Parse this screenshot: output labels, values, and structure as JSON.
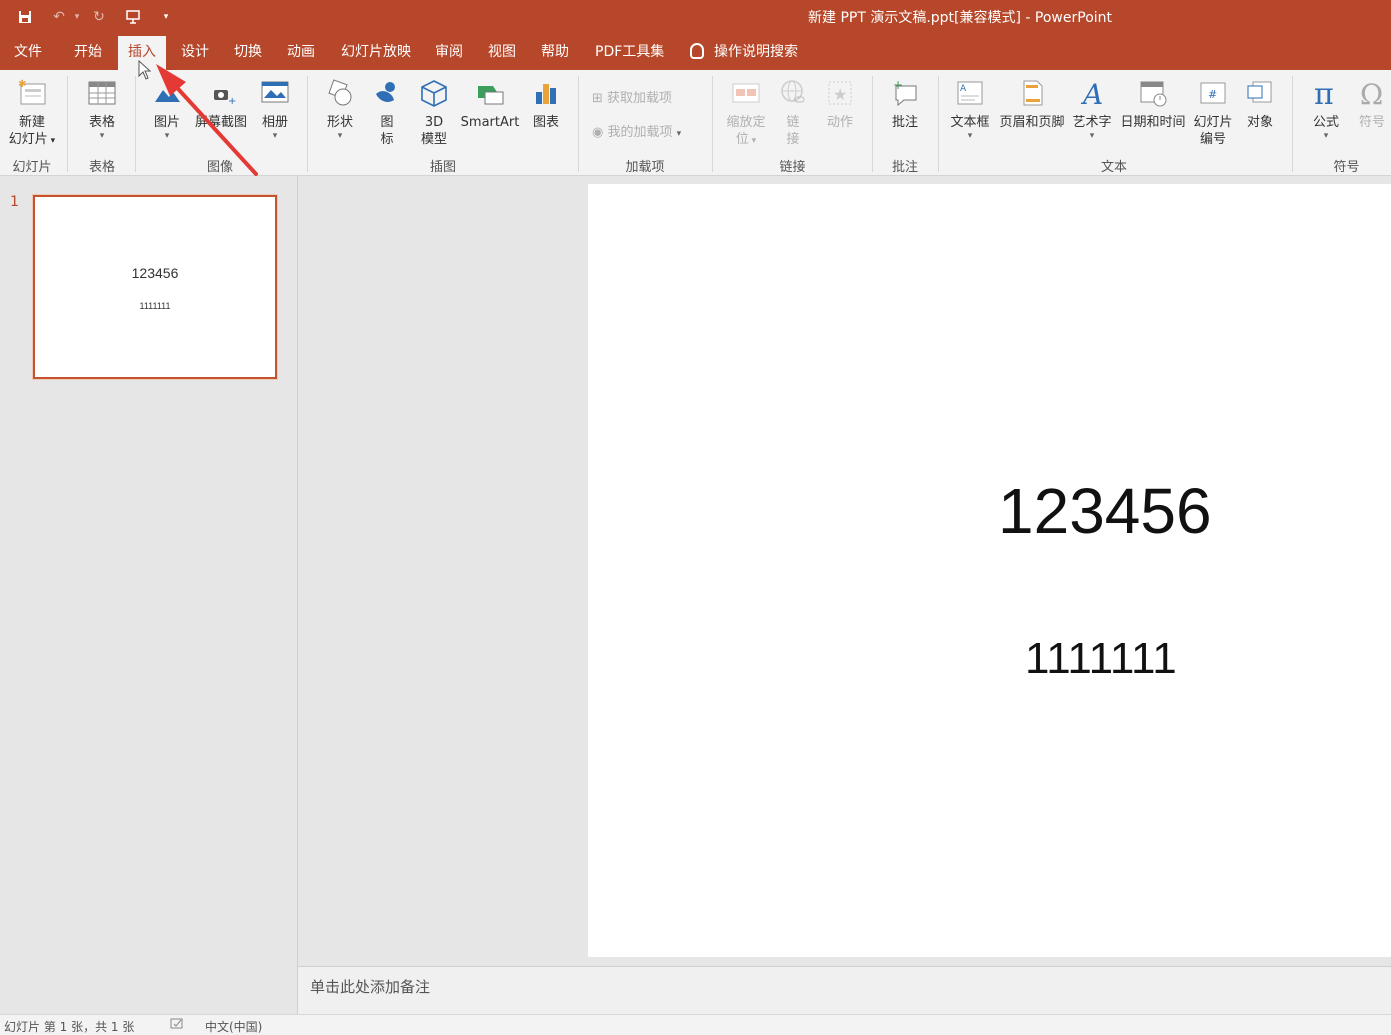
{
  "window": {
    "title": "新建 PPT 演示文稿.ppt[兼容模式]  -  PowerPoint"
  },
  "tabs": [
    {
      "label": "文件"
    },
    {
      "label": "开始"
    },
    {
      "label": "插入"
    },
    {
      "label": "设计"
    },
    {
      "label": "切换"
    },
    {
      "label": "动画"
    },
    {
      "label": "幻灯片放映"
    },
    {
      "label": "审阅"
    },
    {
      "label": "视图"
    },
    {
      "label": "帮助"
    },
    {
      "label": "PDF工具集"
    }
  ],
  "tell_me": "操作说明搜索",
  "ribbon": {
    "new_slide": {
      "line1": "新建",
      "line2": "幻灯片"
    },
    "table": "表格",
    "picture": "图片",
    "screenshot": "屏幕截图",
    "album": "相册",
    "shapes": "形状",
    "icons": {
      "line1": "图",
      "line2": "标"
    },
    "model3d": {
      "line1": "3D",
      "line2": "模型"
    },
    "smartart": "SmartArt",
    "chart": "图表",
    "get_addins": "获取加载项",
    "my_addins": "我的加载项",
    "zoom": {
      "line1": "缩放定",
      "line2": "位"
    },
    "link": {
      "line1": "链",
      "line2": "接"
    },
    "action": "动作",
    "comment": "批注",
    "textbox": "文本框",
    "header_footer": "页眉和页脚",
    "wordart": "艺术字",
    "datetime": "日期和时间",
    "slide_number": {
      "line1": "幻灯片",
      "line2": "编号"
    },
    "object": "对象",
    "equation": "公式",
    "symbol": "符号",
    "groups": {
      "slides": "幻灯片",
      "tables": "表格",
      "images": "图像",
      "illustrations": "插图",
      "addins": "加载项",
      "links": "链接",
      "comments": "批注",
      "text": "文本",
      "symbols": "符号"
    }
  },
  "thumbnail": {
    "number": "1",
    "line1": "123456",
    "line2": "1111111"
  },
  "slide": {
    "line1": "123456",
    "line2": "1111111"
  },
  "notes_placeholder": "单击此处添加备注",
  "status": {
    "slide_info": "幻灯片 第 1 张，共 1 张",
    "language": "中文(中国)"
  },
  "colors": {
    "accent": "#b7472a",
    "annotation_arrow": "#e53935"
  }
}
